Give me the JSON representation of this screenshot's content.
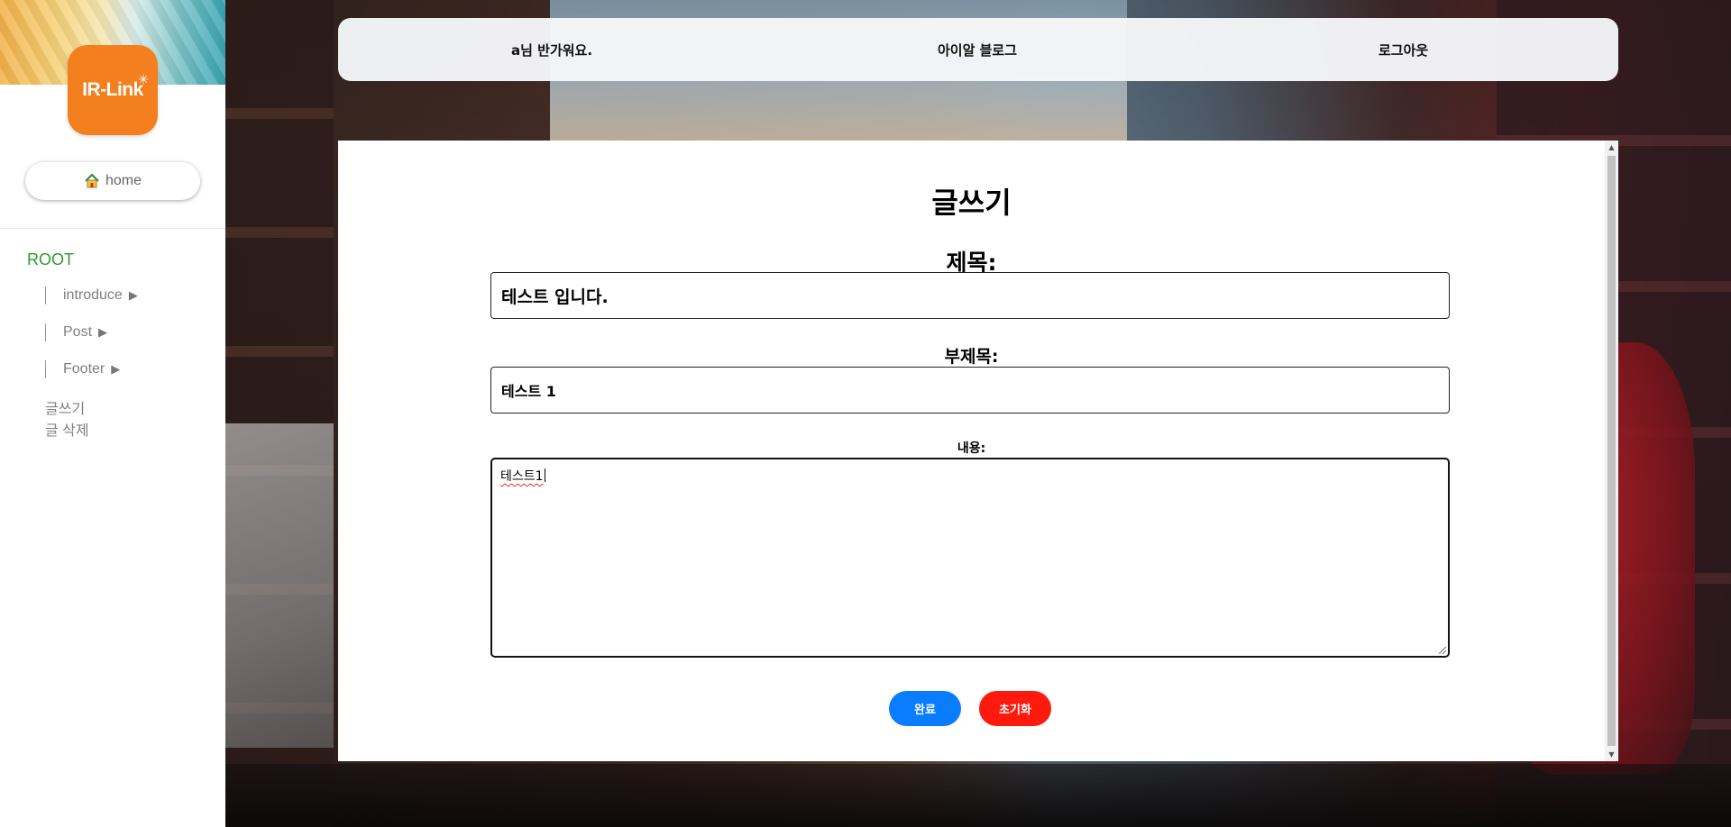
{
  "sidebar": {
    "logo_text": "IR-Link",
    "home_label": "home",
    "root_label": "ROOT",
    "nav_items": [
      {
        "label": "introduce",
        "icon": "triangle-right-icon"
      },
      {
        "label": "Post",
        "icon": "triangle-right-icon"
      },
      {
        "label": "Footer",
        "icon": "triangle-right-icon"
      }
    ],
    "links": [
      {
        "label": "글쓰기"
      },
      {
        "label": "글 삭제"
      }
    ]
  },
  "header": {
    "greeting": "a님 반가워요.",
    "blog_title": "아이알 블로그",
    "logout": "로그아웃"
  },
  "form": {
    "page_title": "글쓰기",
    "title_label": "제목:",
    "title_value": "테스트 입니다.",
    "subtitle_label": "부제목:",
    "subtitle_value": "테스트 1",
    "content_label": "내용:",
    "content_value": "테스트1",
    "submit_label": "완료",
    "reset_label": "초기화"
  },
  "colors": {
    "logo": "#f47f1f",
    "root": "#2e9b2e",
    "submit": "#0a7cff",
    "reset": "#ff1a0d"
  }
}
